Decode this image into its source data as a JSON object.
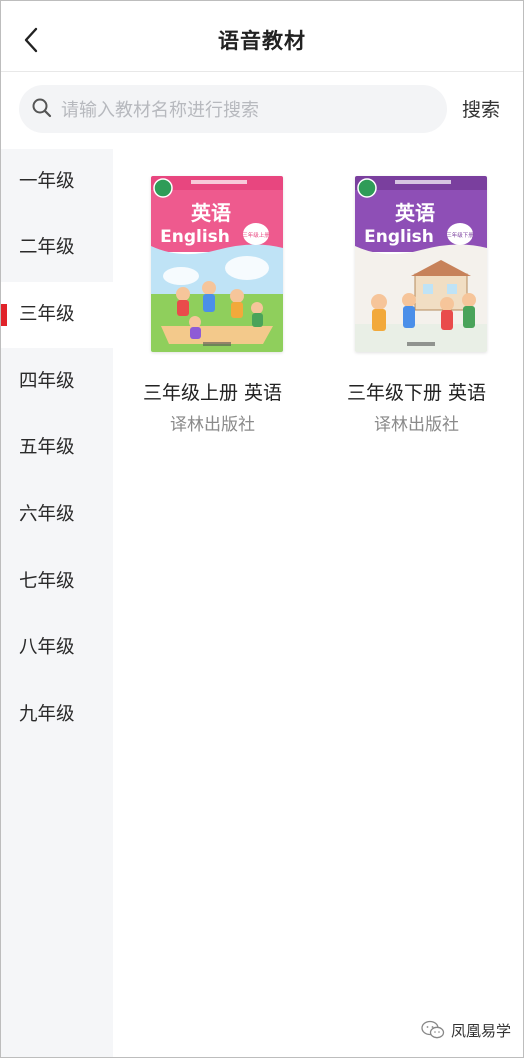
{
  "header": {
    "title": "语音教材"
  },
  "search": {
    "placeholder": "请输入教材名称进行搜索",
    "button_label": "搜索"
  },
  "sidebar": {
    "items": [
      {
        "label": "一年级"
      },
      {
        "label": "二年级"
      },
      {
        "label": "三年级"
      },
      {
        "label": "四年级"
      },
      {
        "label": "五年级"
      },
      {
        "label": "六年级"
      },
      {
        "label": "七年级"
      },
      {
        "label": "八年级"
      },
      {
        "label": "九年级"
      }
    ],
    "active_index": 2,
    "active_color": "#e0232a"
  },
  "books": [
    {
      "name": "三年级上册 英语",
      "publisher": "译林出版社",
      "cover": {
        "title_cn": "英语",
        "title_en": "English",
        "badge": "三年级上册",
        "theme_color": "#e8467f"
      }
    },
    {
      "name": "三年级下册 英语",
      "publisher": "译林出版社",
      "cover": {
        "title_cn": "英语",
        "title_en": "English",
        "badge": "三年级下册",
        "theme_color": "#7a3f9e"
      }
    }
  ],
  "watermark": {
    "text": "凤凰易学"
  }
}
